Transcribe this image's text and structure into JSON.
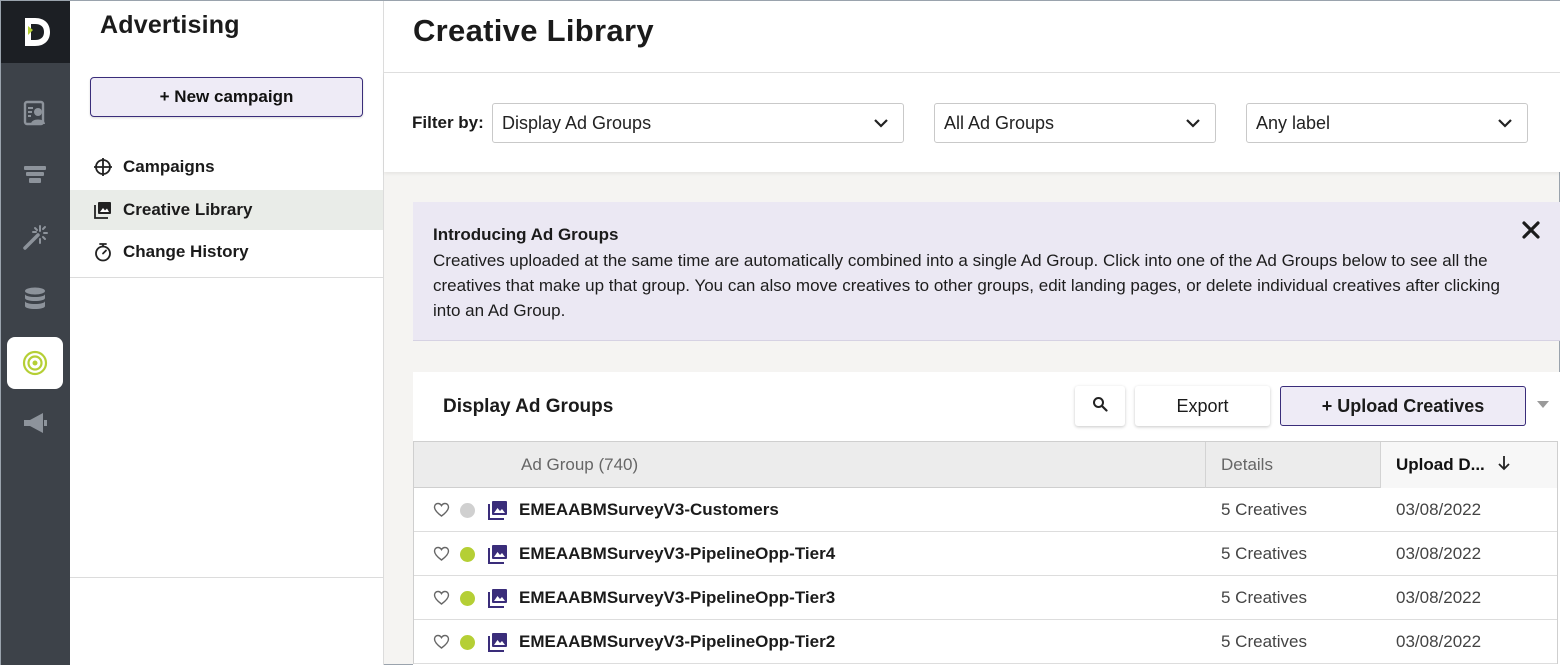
{
  "colors": {
    "rail_bg": "#3d4249",
    "accent_purple": "#3a2d7a",
    "status_active": "#b5cf35",
    "status_inactive": "#d0d0d0",
    "active_rail_icon": "#b5cf35"
  },
  "rail": {
    "logo_icon": "brand-d-logo-icon",
    "items": [
      {
        "icon": "contact-card-icon"
      },
      {
        "icon": "funnel-icon"
      },
      {
        "icon": "magic-wand-icon"
      },
      {
        "icon": "database-icon"
      },
      {
        "icon": "target-icon",
        "active": true
      },
      {
        "icon": "megaphone-icon"
      }
    ]
  },
  "sidebar": {
    "title": "Advertising",
    "new_campaign_label": "+ New campaign",
    "items": [
      {
        "label": "Campaigns",
        "icon": "crosshair-icon"
      },
      {
        "label": "Creative Library",
        "icon": "image-gallery-icon",
        "selected": true
      },
      {
        "label": "Change History",
        "icon": "stopwatch-icon"
      }
    ]
  },
  "header": {
    "title": "Creative Library"
  },
  "filters": {
    "label": "Filter by:",
    "type_select": "Display Ad Groups",
    "group_select": "All Ad Groups",
    "label_select": "Any label"
  },
  "banner": {
    "title": "Introducing Ad Groups",
    "body": "Creatives uploaded at the same time are automatically combined into a single Ad Group. Click into one of the Ad Groups below to see all the creatives that make up that group. You can also move creatives to other groups, edit landing pages, or delete individual creatives after clicking into an Ad Group."
  },
  "table_card": {
    "title": "Display Ad Groups",
    "export_label": "Export",
    "upload_label": "+ Upload Creatives",
    "columns": {
      "ad_group": "Ad Group (740)",
      "details": "Details",
      "upload_date": "Upload D..."
    },
    "rows": [
      {
        "name": "EMEAABMSurveyV3-Customers",
        "details": "5 Creatives",
        "date": "03/08/2022",
        "status": "inactive"
      },
      {
        "name": "EMEAABMSurveyV3-PipelineOpp-Tier4",
        "details": "5 Creatives",
        "date": "03/08/2022",
        "status": "active"
      },
      {
        "name": "EMEAABMSurveyV3-PipelineOpp-Tier3",
        "details": "5 Creatives",
        "date": "03/08/2022",
        "status": "active"
      },
      {
        "name": "EMEAABMSurveyV3-PipelineOpp-Tier2",
        "details": "5 Creatives",
        "date": "03/08/2022",
        "status": "active"
      }
    ]
  }
}
